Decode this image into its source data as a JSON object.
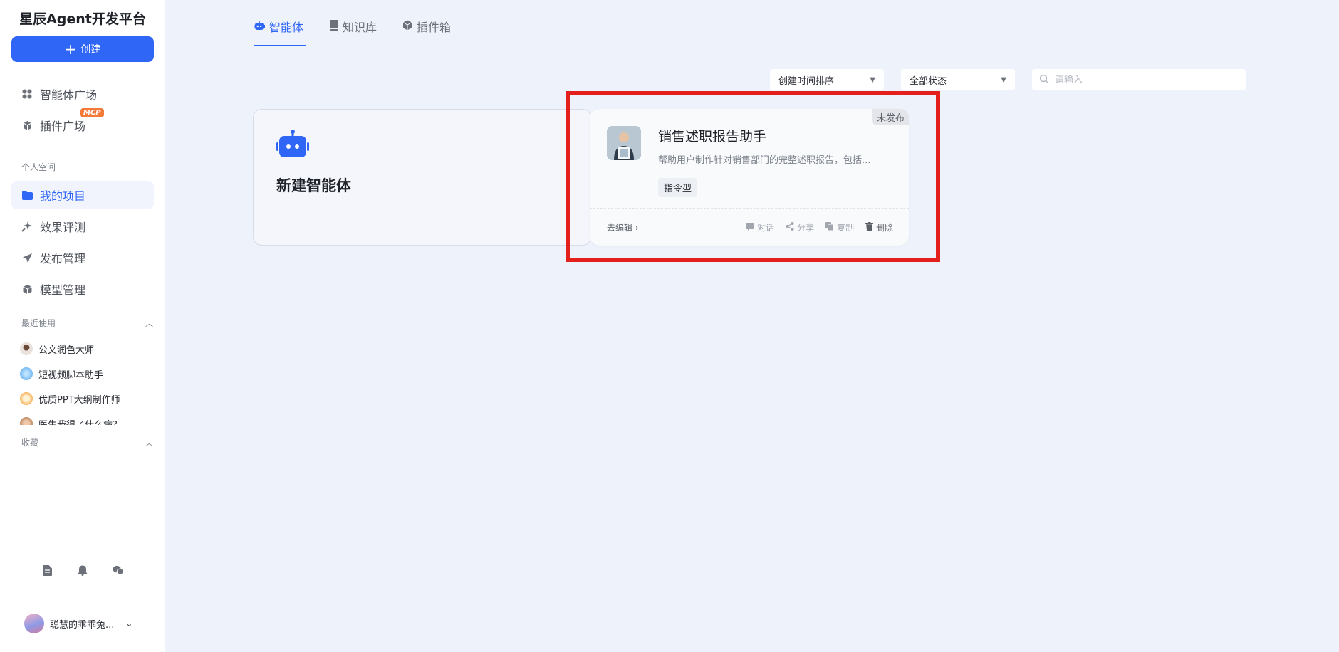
{
  "sidebar": {
    "brand": "星辰Agent开发平台",
    "create_label": "创建",
    "items": [
      {
        "label": "智能体广场",
        "icon": "apps-grid-icon"
      },
      {
        "label": "插件广场",
        "icon": "plugin-cube-icon",
        "badge": "MCP"
      }
    ],
    "personal_label": "个人空间",
    "personal_items": [
      {
        "label": "我的项目",
        "icon": "folder-icon",
        "active": true
      },
      {
        "label": "效果评测",
        "icon": "sparkle-icon"
      },
      {
        "label": "发布管理",
        "icon": "send-icon"
      },
      {
        "label": "模型管理",
        "icon": "cube-icon"
      }
    ],
    "recent_label": "最近使用",
    "recent_items": [
      {
        "label": "公文润色大师"
      },
      {
        "label": "短视频脚本助手"
      },
      {
        "label": "优质PPT大纲制作师"
      },
      {
        "label": "医生我得了什么病?"
      }
    ],
    "favorites_label": "收藏",
    "bottom_icons": [
      "document-icon",
      "bell-icon",
      "wechat-icon"
    ],
    "user_name": "聪慧的乖乖兔..."
  },
  "tabs": [
    {
      "label": "智能体",
      "icon": "robot-icon",
      "active": true
    },
    {
      "label": "知识库",
      "icon": "book-icon"
    },
    {
      "label": "插件箱",
      "icon": "box-icon"
    }
  ],
  "filters": {
    "sort_value": "创建时间排序",
    "status_value": "全部状态",
    "search_placeholder": "请输入"
  },
  "new_card": {
    "title": "新建智能体"
  },
  "agent_card": {
    "status": "未发布",
    "name": "销售述职报告助手",
    "description": "帮助用户制作针对销售部门的完整述职报告，包括...",
    "tag": "指令型",
    "edit_label": "去编辑",
    "actions": [
      "对话",
      "分享",
      "复制",
      "删除"
    ]
  },
  "colors": {
    "accent": "#2f66f6",
    "highlight": "#e3201b",
    "background": "#eef2fb"
  }
}
